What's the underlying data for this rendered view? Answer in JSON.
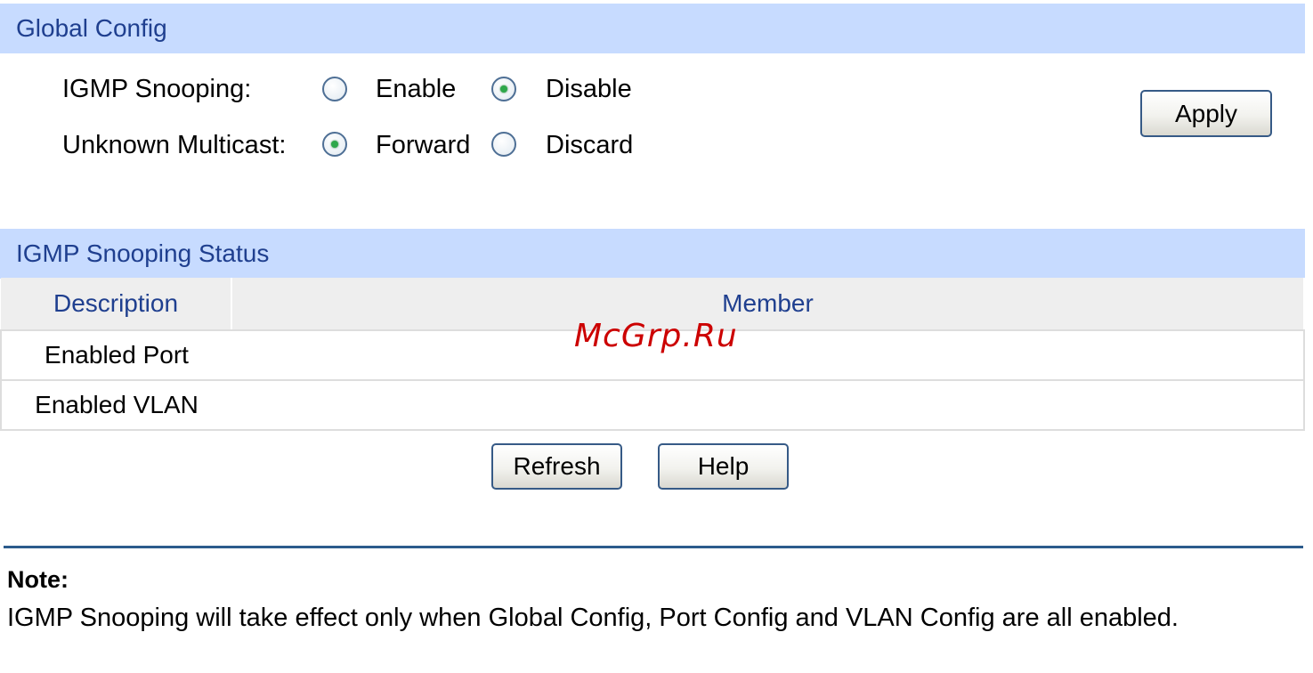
{
  "global_config": {
    "header": "Global Config",
    "igmp_snooping": {
      "label": "IGMP Snooping:",
      "options": [
        "Enable",
        "Disable"
      ],
      "selected": "Disable"
    },
    "unknown_multicast": {
      "label": "Unknown Multicast:",
      "options": [
        "Forward",
        "Discard"
      ],
      "selected": "Forward"
    },
    "apply_label": "Apply"
  },
  "status": {
    "header": "IGMP Snooping Status",
    "columns": [
      "Description",
      "Member"
    ],
    "rows": [
      {
        "description": "Enabled Port",
        "member": ""
      },
      {
        "description": "Enabled VLAN",
        "member": ""
      }
    ],
    "refresh_label": "Refresh",
    "help_label": "Help"
  },
  "note": {
    "title": "Note:",
    "text": "IGMP Snooping will take effect only when Global Config, Port Config and VLAN Config are all enabled."
  },
  "watermark": "McGrp.Ru",
  "colors": {
    "section_header_bg": "#c7dbff",
    "header_text": "#1f3f8f",
    "divider": "#2c5b8c",
    "radio_checked": "#2ea84a"
  }
}
